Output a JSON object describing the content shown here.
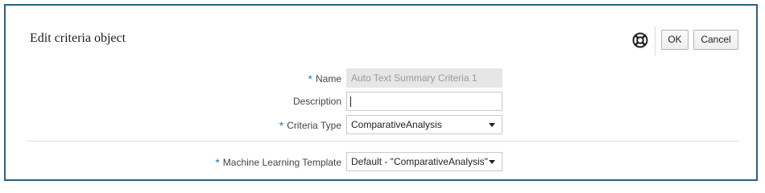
{
  "dialog": {
    "title": "Edit criteria object"
  },
  "toolbar": {
    "help_icon": "help-lifebuoy-icon",
    "ok_label": "OK",
    "cancel_label": "Cancel"
  },
  "form": {
    "required_marker": "*",
    "name": {
      "label": "Name",
      "value": "Auto Text Summary Criteria 1",
      "required": true
    },
    "description": {
      "label": "Description",
      "value": ""
    },
    "criteria_type": {
      "label": "Criteria Type",
      "value": "ComparativeAnalysis",
      "required": true
    },
    "ml_template": {
      "label": "Machine Learning Template",
      "value": "Default - \"ComparativeAnalysis\"",
      "required": true
    }
  },
  "colors": {
    "frame_border": "#2a5f84",
    "required_marker": "#2a7ab8"
  }
}
